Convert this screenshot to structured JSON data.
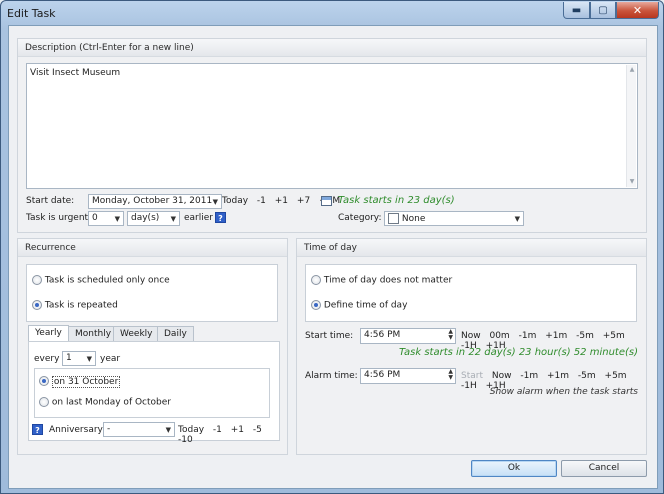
{
  "window": {
    "title": "Edit Task",
    "min_glyph": "▬",
    "max_glyph": "▢",
    "close_glyph": "✕"
  },
  "description": {
    "header": "Description (Ctrl-Enter for a new line)",
    "value": "Visit Insect Museum"
  },
  "start_date": {
    "label": "Start date:",
    "value": "Monday, October 31, 2011",
    "quick": [
      "Today",
      "-1",
      "+1",
      "+7",
      "+1M"
    ],
    "info": "Task starts in 23 day(s)"
  },
  "urgent": {
    "label": "Task is urgent",
    "amount": "0",
    "unit": "day(s)",
    "suffix": "earlier",
    "help": "?"
  },
  "category": {
    "label": "Category:",
    "value": "None"
  },
  "recurrence": {
    "header": "Recurrence",
    "options": [
      "Task is scheduled only once",
      "Task is repeated"
    ],
    "selected_index": 1,
    "tabs": [
      "Yearly",
      "Monthly",
      "Weekly",
      "Daily"
    ],
    "active_tab": "Yearly",
    "every_label": "every",
    "every_value": "1",
    "every_unit": "year",
    "day_options": [
      "on 31 October",
      "on last Monday of October"
    ],
    "anniversary_label": "Anniversary:",
    "anniversary_value": "-",
    "anniversary_quick": [
      "Today",
      "-1",
      "+1",
      "-5",
      "-10"
    ],
    "help": "?"
  },
  "time_of_day": {
    "header": "Time of day",
    "options": [
      "Time of day does not matter",
      "Define time of day"
    ],
    "selected_index": 1,
    "start_label": "Start time:",
    "start_value": "4:56 PM",
    "start_quick": [
      "Now",
      "00m",
      "-1m",
      "+1m",
      "-5m",
      "+5m",
      "-1H",
      "+1H"
    ],
    "start_info": "Task starts in 22 day(s) 23 hour(s) 52 minute(s)",
    "alarm_label": "Alarm time:",
    "alarm_value": "4:56 PM",
    "alarm_quick": [
      "Start",
      "Now",
      "-1m",
      "+1m",
      "-5m",
      "+5m",
      "-1H",
      "+1H"
    ],
    "alarm_info": "Show alarm when the task starts"
  },
  "buttons": {
    "ok": "Ok",
    "cancel": "Cancel"
  },
  "icons": {
    "dropdown": "▼",
    "spin_up": "▲",
    "spin_down": "▼",
    "scroll_up": "▲",
    "scroll_down": "▼"
  }
}
